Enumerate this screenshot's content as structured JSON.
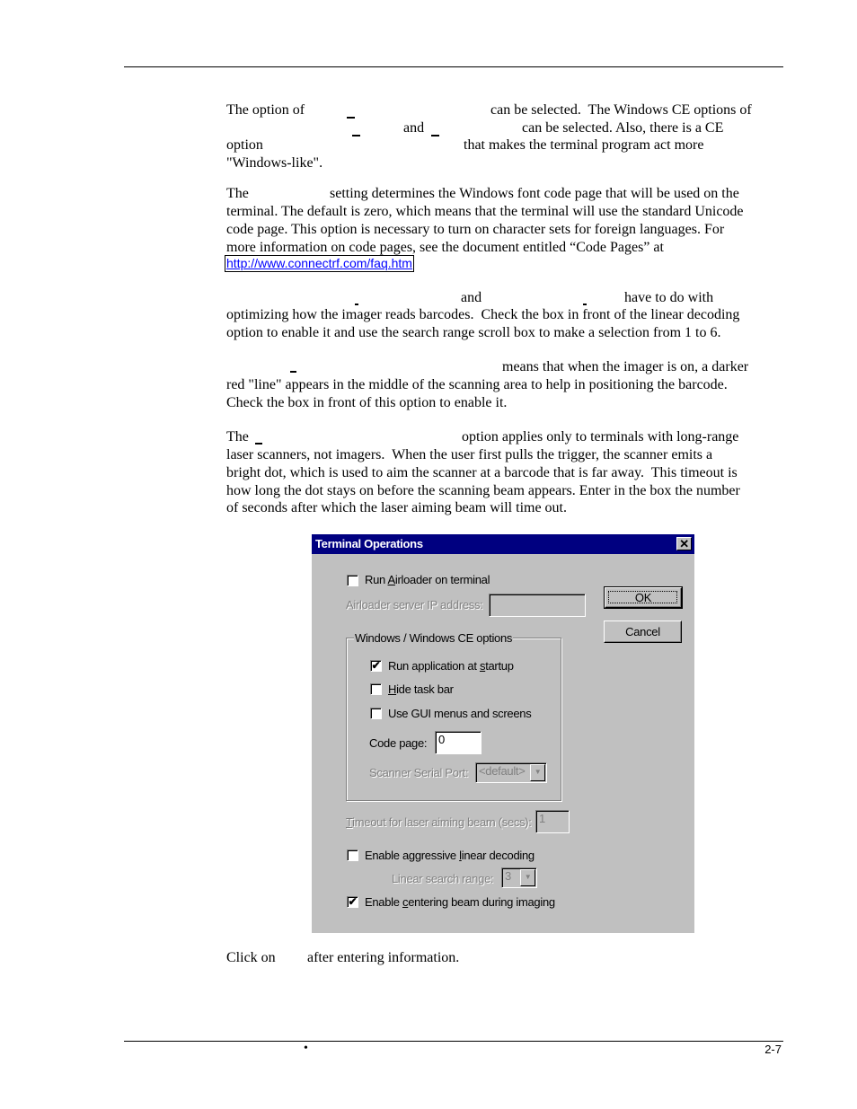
{
  "document": {
    "paragraphs": {
      "p1": {
        "l1a": "The option of",
        "l1b": "can be selected.  The Windows CE options of",
        "l2a": "and",
        "l2b": "can be selected. Also, there is a CE",
        "l3a": "option",
        "l3b": "that makes the terminal program act more",
        "l4": "\"Windows-like\"."
      },
      "p2": {
        "l1a": "The",
        "l1b": "setting determines the Windows font code page that will be used on the",
        "l2": "terminal. The default is zero, which means that the terminal will use the standard Unicode",
        "l3": "code page. This option is necessary to turn on character sets for foreign languages. For",
        "l4": "more information on code pages, see the document entitled “Code Pages” at",
        "link": "http://www.connectrf.com/faq.htm"
      },
      "p3": {
        "l1a": "and",
        "l1b": "have to do with",
        "l2": "optimizing how the imager reads barcodes.  Check the box in front of the linear decoding",
        "l3": "option to enable it and use the search range scroll box to make a selection from 1 to 6."
      },
      "p4": {
        "l1": "means that when the imager is on, a darker",
        "l2": "red \"line\" appears in the middle of the scanning area to help in positioning the barcode.",
        "l3": "Check the box in front of this option to enable it."
      },
      "p5": {
        "l1a": "The",
        "l1b": "option applies only to terminals with long-range",
        "l2": "laser scanners, not imagers.  When the user first pulls the trigger, the scanner emits a",
        "l3": "bright dot, which is used to aim the scanner at a barcode that is far away.  This timeout is",
        "l4": "how long the dot stays on before the scanning beam appears. Enter in the box the number",
        "l5": "of seconds after which the laser aiming beam will time out."
      },
      "p6": {
        "a": "Click on",
        "b": "after entering information."
      }
    },
    "footer": {
      "page_number": "2-7",
      "bullet": "•"
    }
  },
  "dialog": {
    "title": "Terminal Operations",
    "close_glyph": "✕",
    "run_airloader": {
      "label_pre": "Run ",
      "label_ul": "A",
      "label_post": "irloader on terminal",
      "checked": false
    },
    "airloader_ip": {
      "label": "Airloader server IP address:",
      "value": ""
    },
    "ok_label": "OK",
    "cancel_label": "Cancel",
    "group_title": "Windows / Windows CE options",
    "run_app": {
      "label_pre": "Run application at ",
      "label_ul": "s",
      "label_post": "tartup",
      "checked": true
    },
    "hide_taskbar": {
      "label_pre": "",
      "label_ul": "H",
      "label_post": "ide task bar",
      "checked": false
    },
    "use_gui": {
      "label": "Use GUI menus and screens",
      "checked": false
    },
    "code_page": {
      "label": "Code page:",
      "value": "0"
    },
    "scanner_port": {
      "label": "Scanner Serial Port:",
      "value": "<default>"
    },
    "timeout": {
      "label_ul": "T",
      "label_post": "imeout for laser aiming beam (secs):",
      "value": "1"
    },
    "aggressive": {
      "label_pre": "Enable aggressive ",
      "label_ul": "l",
      "label_post": "inear decoding",
      "checked": false
    },
    "search_range": {
      "label": "Linear search range:",
      "value": "3"
    },
    "centering": {
      "label_pre": "Enable ",
      "label_ul": "c",
      "label_post": "entering beam during imaging",
      "checked": true
    },
    "check_glyph": "✔",
    "arrow_glyph": "▼"
  },
  "colors": {
    "titlebar": "#000080",
    "face": "#c0c0c0",
    "link": "#0000ff"
  }
}
